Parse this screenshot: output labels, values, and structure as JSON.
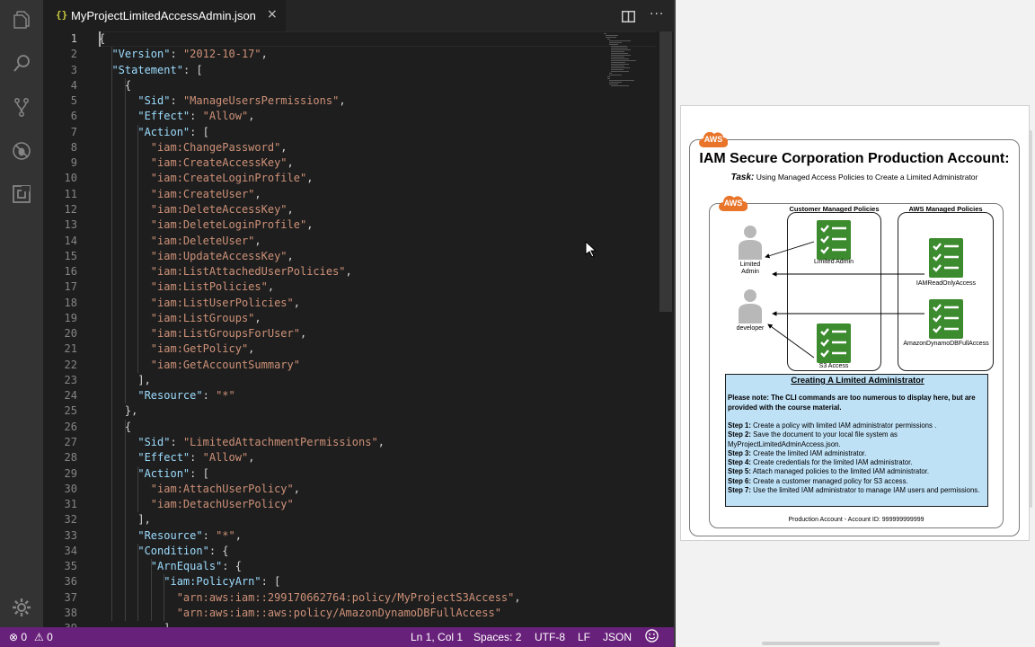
{
  "editor": {
    "tab": {
      "icon": "{}",
      "title": "MyProjectLimitedAccessAdmin.json",
      "close": "×"
    },
    "actions": {
      "split": "split-editor-icon",
      "more": "···"
    },
    "lines": [
      [
        [
          "p",
          "{"
        ]
      ],
      [
        [
          "p",
          "  "
        ],
        [
          "k",
          "\"Version\""
        ],
        [
          "p",
          ": "
        ],
        [
          "s",
          "\"2012-10-17\""
        ],
        [
          "p",
          ","
        ]
      ],
      [
        [
          "p",
          "  "
        ],
        [
          "k",
          "\"Statement\""
        ],
        [
          "p",
          ": ["
        ]
      ],
      [
        [
          "p",
          "    {"
        ]
      ],
      [
        [
          "p",
          "      "
        ],
        [
          "k",
          "\"Sid\""
        ],
        [
          "p",
          ": "
        ],
        [
          "s",
          "\"ManageUsersPermissions\""
        ],
        [
          "p",
          ","
        ]
      ],
      [
        [
          "p",
          "      "
        ],
        [
          "k",
          "\"Effect\""
        ],
        [
          "p",
          ": "
        ],
        [
          "s",
          "\"Allow\""
        ],
        [
          "p",
          ","
        ]
      ],
      [
        [
          "p",
          "      "
        ],
        [
          "k",
          "\"Action\""
        ],
        [
          "p",
          ": ["
        ]
      ],
      [
        [
          "p",
          "        "
        ],
        [
          "s",
          "\"iam:ChangePassword\""
        ],
        [
          "p",
          ","
        ]
      ],
      [
        [
          "p",
          "        "
        ],
        [
          "s",
          "\"iam:CreateAccessKey\""
        ],
        [
          "p",
          ","
        ]
      ],
      [
        [
          "p",
          "        "
        ],
        [
          "s",
          "\"iam:CreateLoginProfile\""
        ],
        [
          "p",
          ","
        ]
      ],
      [
        [
          "p",
          "        "
        ],
        [
          "s",
          "\"iam:CreateUser\""
        ],
        [
          "p",
          ","
        ]
      ],
      [
        [
          "p",
          "        "
        ],
        [
          "s",
          "\"iam:DeleteAccessKey\""
        ],
        [
          "p",
          ","
        ]
      ],
      [
        [
          "p",
          "        "
        ],
        [
          "s",
          "\"iam:DeleteLoginProfile\""
        ],
        [
          "p",
          ","
        ]
      ],
      [
        [
          "p",
          "        "
        ],
        [
          "s",
          "\"iam:DeleteUser\""
        ],
        [
          "p",
          ","
        ]
      ],
      [
        [
          "p",
          "        "
        ],
        [
          "s",
          "\"iam:UpdateAccessKey\""
        ],
        [
          "p",
          ","
        ]
      ],
      [
        [
          "p",
          "        "
        ],
        [
          "s",
          "\"iam:ListAttachedUserPolicies\""
        ],
        [
          "p",
          ","
        ]
      ],
      [
        [
          "p",
          "        "
        ],
        [
          "s",
          "\"iam:ListPolicies\""
        ],
        [
          "p",
          ","
        ]
      ],
      [
        [
          "p",
          "        "
        ],
        [
          "s",
          "\"iam:ListUserPolicies\""
        ],
        [
          "p",
          ","
        ]
      ],
      [
        [
          "p",
          "        "
        ],
        [
          "s",
          "\"iam:ListGroups\""
        ],
        [
          "p",
          ","
        ]
      ],
      [
        [
          "p",
          "        "
        ],
        [
          "s",
          "\"iam:ListGroupsForUser\""
        ],
        [
          "p",
          ","
        ]
      ],
      [
        [
          "p",
          "        "
        ],
        [
          "s",
          "\"iam:GetPolicy\""
        ],
        [
          "p",
          ","
        ]
      ],
      [
        [
          "p",
          "        "
        ],
        [
          "s",
          "\"iam:GetAccountSummary\""
        ]
      ],
      [
        [
          "p",
          "      ],"
        ]
      ],
      [
        [
          "p",
          "      "
        ],
        [
          "k",
          "\"Resource\""
        ],
        [
          "p",
          ": "
        ],
        [
          "s",
          "\"*\""
        ]
      ],
      [
        [
          "p",
          "    },"
        ]
      ],
      [
        [
          "p",
          "    {"
        ]
      ],
      [
        [
          "p",
          "      "
        ],
        [
          "k",
          "\"Sid\""
        ],
        [
          "p",
          ": "
        ],
        [
          "s",
          "\"LimitedAttachmentPermissions\""
        ],
        [
          "p",
          ","
        ]
      ],
      [
        [
          "p",
          "      "
        ],
        [
          "k",
          "\"Effect\""
        ],
        [
          "p",
          ": "
        ],
        [
          "s",
          "\"Allow\""
        ],
        [
          "p",
          ","
        ]
      ],
      [
        [
          "p",
          "      "
        ],
        [
          "k",
          "\"Action\""
        ],
        [
          "p",
          ": ["
        ]
      ],
      [
        [
          "p",
          "        "
        ],
        [
          "s",
          "\"iam:AttachUserPolicy\""
        ],
        [
          "p",
          ","
        ]
      ],
      [
        [
          "p",
          "        "
        ],
        [
          "s",
          "\"iam:DetachUserPolicy\""
        ]
      ],
      [
        [
          "p",
          "      ],"
        ]
      ],
      [
        [
          "p",
          "      "
        ],
        [
          "k",
          "\"Resource\""
        ],
        [
          "p",
          ": "
        ],
        [
          "s",
          "\"*\""
        ],
        [
          "p",
          ","
        ]
      ],
      [
        [
          "p",
          "      "
        ],
        [
          "k",
          "\"Condition\""
        ],
        [
          "p",
          ": {"
        ]
      ],
      [
        [
          "p",
          "        "
        ],
        [
          "k",
          "\"ArnEquals\""
        ],
        [
          "p",
          ": {"
        ]
      ],
      [
        [
          "p",
          "          "
        ],
        [
          "k",
          "\"iam:PolicyArn\""
        ],
        [
          "p",
          ": ["
        ]
      ],
      [
        [
          "p",
          "            "
        ],
        [
          "s",
          "\"arn:aws:iam::299170662764:policy/MyProjectS3Access\""
        ],
        [
          "p",
          ","
        ]
      ],
      [
        [
          "p",
          "            "
        ],
        [
          "s",
          "\"arn:aws:iam::aws:policy/AmazonDynamoDBFullAccess\""
        ]
      ],
      [
        [
          "p",
          "          ]"
        ]
      ]
    ]
  },
  "status": {
    "errors": "0",
    "warnings": "0",
    "position": "Ln 1, Col 1",
    "spaces": "Spaces: 2",
    "encoding": "UTF-8",
    "eol": "LF",
    "language": "JSON",
    "feedback": "smiley-icon"
  },
  "diagram": {
    "aws_badge": "AWS",
    "title": "IAM Secure Corporation Production Account:",
    "task_label": "Task:",
    "task_text": "Using Managed Access Policies to Create a Limited Administrator",
    "customer_managed": "Customer Managed Policies",
    "aws_managed": "AWS Managed Policies",
    "users": {
      "admin": "Limited\nAdmin",
      "developer": "developer"
    },
    "policies": {
      "limited_admin": "Limited Admin",
      "s3": "S3 Access",
      "iam_readonly": "IAMReadOnlyAccess",
      "dynamo": "AmazonDynamoDBFullAccess"
    },
    "info_title": "Creating A Limited Administrator",
    "info_note": "Please note: The CLI commands are too numerous to display here, but are provided with the course material.",
    "steps": [
      {
        "label": "Step 1:",
        "text": "Create a policy with limited IAM administrator permissions ."
      },
      {
        "label": "Step 2:",
        "text": "Save the document to your local file system as MyProjectLimitedAdminAccess.json."
      },
      {
        "label": "Step 3:",
        "text": "Create the limited IAM administrator."
      },
      {
        "label": "Step 4:",
        "text": "Create credentials for the limited IAM administrator."
      },
      {
        "label": "Step 5:",
        "text": "Attach managed policies to the limited IAM administrator."
      },
      {
        "label": "Step 6:",
        "text": "Create a customer managed policy for S3 access."
      },
      {
        "label": "Step 7:",
        "text": "Use the limited IAM administrator to manage IAM users and permissions."
      }
    ],
    "footer": "Production Account - Account ID: 999999999999",
    "colors": {
      "aws_orange": "#e8752a",
      "policy_green": "#3d8b2f",
      "info_blue": "#bfe1f6",
      "status_purple": "#68217a"
    }
  }
}
